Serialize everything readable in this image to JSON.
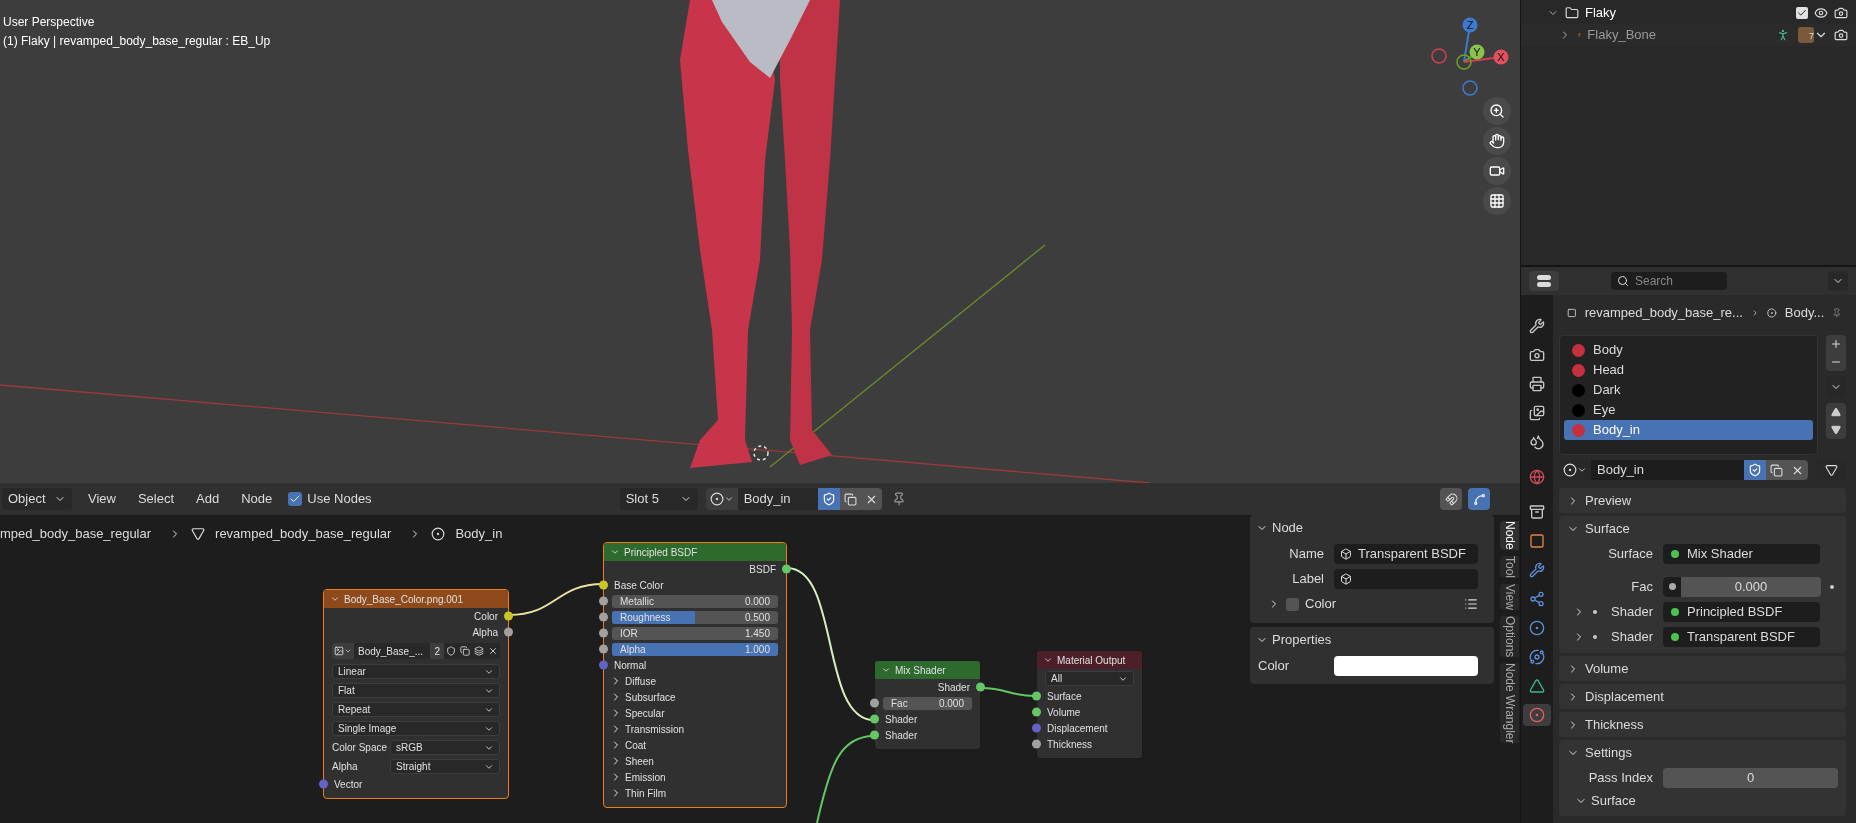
{
  "viewport": {
    "overlay_lines": [
      "User Perspective",
      "(1) Flaky | revamped_body_base_regular : EB_Up"
    ],
    "gizmo_axes": [
      {
        "label": "Z"
      },
      {
        "label": "Y"
      },
      {
        "label": "X"
      }
    ]
  },
  "outliner": {
    "items": [
      {
        "name": "Flaky",
        "expanded": true,
        "checked": true
      },
      {
        "name": "Flaky_Bone",
        "expanded": false,
        "count": "7"
      }
    ]
  },
  "node_editor": {
    "header": {
      "mode": "Object",
      "menus": [
        "View",
        "Select",
        "Add",
        "Node"
      ],
      "use_nodes": {
        "label": "Use Nodes",
        "checked": true
      },
      "slot": "Slot 5",
      "material": "Body_in"
    },
    "breadcrumb": [
      "mped_body_base_regular",
      "revamped_body_base_regular",
      "Body_in"
    ],
    "nodes": [
      {
        "title": "Body_Base_Color.png.001",
        "color": "#8f4a1c",
        "selected": true,
        "rows": [
          {
            "kind": "output",
            "label": "Color",
            "color": "#c7c729"
          },
          {
            "kind": "output",
            "label": "Alpha",
            "color": "#a1a1a1"
          },
          {
            "kind": "image",
            "name": "Body_Base_...",
            "users": "2"
          },
          {
            "kind": "dropdown",
            "value": "Linear"
          },
          {
            "kind": "dropdown",
            "value": "Flat"
          },
          {
            "kind": "dropdown",
            "value": "Repeat"
          },
          {
            "kind": "dropdown",
            "value": "Single Image"
          },
          {
            "kind": "labeled_dropdown",
            "label": "Color Space",
            "value": "sRGB"
          },
          {
            "kind": "labeled_dropdown",
            "label": "Alpha",
            "value": "Straight"
          },
          {
            "kind": "input",
            "label": "Vector",
            "color": "#6363c7"
          }
        ]
      },
      {
        "title": "Principled BSDF",
        "color": "#2e6a2e",
        "selected": true,
        "rows": [
          {
            "kind": "output",
            "label": "BSDF",
            "color": "#63c763"
          },
          {
            "kind": "input",
            "label": "Base Color",
            "color": "#c7c729"
          },
          {
            "kind": "number",
            "label": "Metallic",
            "value": "0.000",
            "color": "#a1a1a1"
          },
          {
            "kind": "slider",
            "label": "Roughness",
            "value": "0.500",
            "level": 0.5,
            "color": "#a1a1a1"
          },
          {
            "kind": "number",
            "label": "IOR",
            "value": "1.450",
            "color": "#a1a1a1"
          },
          {
            "kind": "slider",
            "label": "Alpha",
            "value": "1.000",
            "level": 1,
            "color": "#a1a1a1"
          },
          {
            "kind": "input",
            "label": "Normal",
            "color": "#6363c7"
          },
          {
            "kind": "panel",
            "label": "Diffuse",
            "expanded": false
          },
          {
            "kind": "panel",
            "label": "Subsurface",
            "expanded": false
          },
          {
            "kind": "panel",
            "label": "Specular",
            "expanded": false
          },
          {
            "kind": "panel",
            "label": "Transmission",
            "expanded": false
          },
          {
            "kind": "panel",
            "label": "Coat",
            "expanded": false
          },
          {
            "kind": "panel",
            "label": "Sheen",
            "expanded": false
          },
          {
            "kind": "panel",
            "label": "Emission",
            "expanded": false
          },
          {
            "kind": "panel",
            "label": "Thin Film",
            "expanded": false
          }
        ]
      },
      {
        "title": "Mix Shader",
        "color": "#2e6a2e",
        "selected": false,
        "rows": [
          {
            "kind": "output",
            "label": "Shader",
            "color": "#63c763"
          },
          {
            "kind": "number",
            "label": "Fac",
            "value": "0.000",
            "color": "#a1a1a1"
          },
          {
            "kind": "input",
            "label": "Shader",
            "color": "#63c763"
          },
          {
            "kind": "input",
            "label": "Shader",
            "color": "#63c763"
          }
        ]
      },
      {
        "title": "Material Output",
        "color": "#4d1f28",
        "selected": false,
        "rows": [
          {
            "kind": "dropdown",
            "value": "All"
          },
          {
            "kind": "input",
            "label": "Surface",
            "color": "#63c763"
          },
          {
            "kind": "input",
            "label": "Volume",
            "color": "#63c763"
          },
          {
            "kind": "input",
            "label": "Displacement",
            "color": "#6363c7"
          },
          {
            "kind": "input",
            "label": "Thickness",
            "color": "#a1a1a1"
          }
        ]
      }
    ],
    "sidebar": {
      "node_panel": {
        "title": "Node",
        "expanded": true,
        "name_label": "Name",
        "name": "Transparent BSDF",
        "label_label": "Label",
        "color_label": "Color",
        "color_checked": false,
        "color_expanded": false
      },
      "properties_panel": {
        "title": "Properties",
        "expanded": true,
        "color_label": "Color"
      },
      "tabs": [
        {
          "label": "Node",
          "selected": true
        },
        {
          "label": "Tool",
          "selected": false
        },
        {
          "label": "View",
          "selected": false
        },
        {
          "label": "Options",
          "selected": false
        },
        {
          "label": "Node Wrangler",
          "selected": false
        }
      ]
    }
  },
  "properties": {
    "search_placeholder": "Search",
    "tabs": [
      {
        "selected": false
      },
      {
        "selected": false
      },
      {
        "selected": false
      },
      {
        "selected": false
      },
      {
        "selected": false
      },
      {
        "selected": false
      },
      {
        "selected": false
      },
      {
        "selected": false
      },
      {
        "selected": false
      },
      {
        "selected": false
      },
      {
        "selected": false
      },
      {
        "selected": false
      },
      {
        "selected": false
      },
      {
        "selected": true
      }
    ],
    "breadcrumb": [
      "revamped_body_base_re...",
      "Body..."
    ],
    "slots": [
      {
        "name": "Body",
        "color": "#c4303e",
        "selected": false
      },
      {
        "name": "Head",
        "color": "#c4303e",
        "selected": false
      },
      {
        "name": "Dark",
        "color": "#000000",
        "selected": false
      },
      {
        "name": "Eye",
        "color": "#000000",
        "selected": false
      },
      {
        "name": "Body_in",
        "color": "#c4303e",
        "selected": true
      }
    ],
    "material": "Body_in",
    "panels": [
      {
        "label": "Preview",
        "expanded": false
      },
      {
        "label": "Surface",
        "expanded": true,
        "rows": [
          {
            "kind": "link",
            "label": "Surface",
            "value": "Mix Shader",
            "expandable": false
          },
          {
            "kind": "value",
            "label": "Fac",
            "value": "0.000",
            "linkable": true
          },
          {
            "kind": "link",
            "label": "Shader",
            "value": "Principled BSDF",
            "expandable": true
          },
          {
            "kind": "link",
            "label": "Shader",
            "value": "Transparent BSDF",
            "expandable": true
          }
        ]
      },
      {
        "label": "Volume",
        "expanded": false
      },
      {
        "label": "Displacement",
        "expanded": false
      },
      {
        "label": "Thickness",
        "expanded": false
      },
      {
        "label": "Settings",
        "expanded": true,
        "rows": [
          {
            "kind": "value",
            "label": "Pass Index",
            "value": "0",
            "linkable": false
          },
          {
            "kind": "subpanel",
            "label": "Surface",
            "expanded": true
          }
        ]
      }
    ]
  }
}
